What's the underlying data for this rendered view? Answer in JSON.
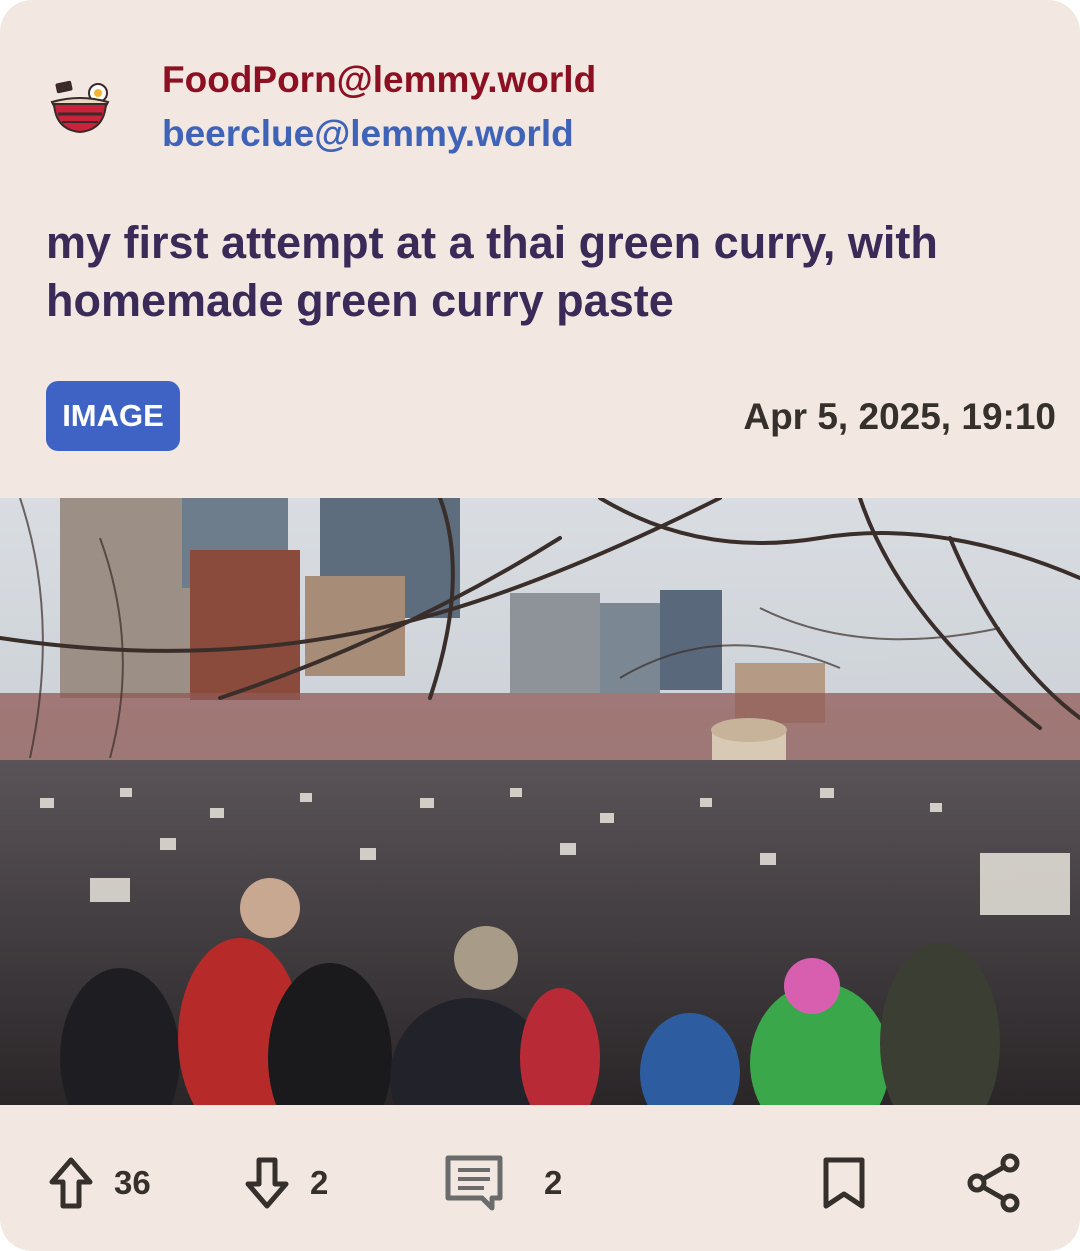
{
  "post": {
    "community": "FoodPorn@lemmy.world",
    "author": "beerclue@lemmy.world",
    "title": "my first attempt at a thai green curry, with homemade green curry paste",
    "type_badge": "IMAGE",
    "date": "Apr 5, 2025, 19:10"
  },
  "actions": {
    "upvotes": "36",
    "downvotes": "2",
    "comments": "2"
  },
  "icons": {
    "community": "ramen-bowl-icon",
    "upvote": "arrow-up-icon",
    "downvote": "arrow-down-icon",
    "comments": "comment-icon",
    "save": "bookmark-icon",
    "share": "share-icon"
  },
  "colors": {
    "card_background": "#f2e8e1",
    "community": "#8c1021",
    "author": "#3f63b9",
    "title": "#3a2a58",
    "badge": "#3f63c4"
  }
}
